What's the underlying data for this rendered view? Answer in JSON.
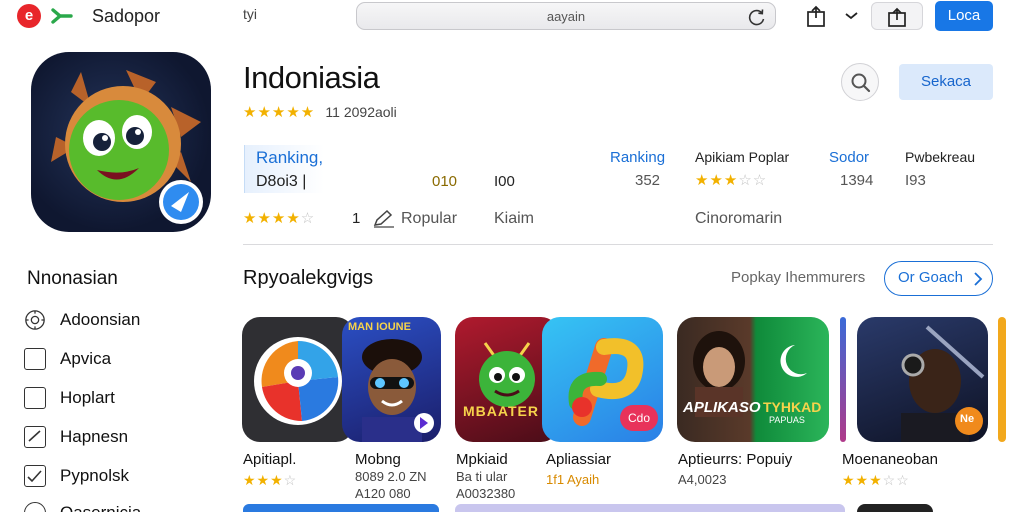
{
  "topbar": {
    "brand_letter": "e",
    "brand_name": "Sadopor",
    "small_label": "tyi",
    "url": "aayain",
    "login_label": "Loca"
  },
  "hero": {
    "title": "Indoniasia",
    "rating_stars": "★★★★",
    "rating_half": "★",
    "rating_text": "11 2092aoli",
    "search_button": "Sekaca",
    "ranking_label": "Ranking,",
    "ranking_value": "D8oi3 |",
    "col1_value": "010",
    "col2_value": "I00",
    "col3_label": "Ranking",
    "col3_value": "352",
    "col4_label": "Apikiam Poplar",
    "col4_stars_on": "★★★",
    "col4_stars_off": "☆☆",
    "col5_label": "Sodor",
    "col5_value": "1394",
    "col6_label": "Pwbekreau",
    "col6_value": "I93",
    "row3_stars_on": "★★★★",
    "row3_stars_off": "☆",
    "row3_count": "1",
    "popular_label": "Ropular",
    "claim_label": "Kiaim",
    "community_label": "Cinoromarin"
  },
  "sidebar": {
    "title": "Nnonasian",
    "items": [
      {
        "label": "Adoonsian"
      },
      {
        "label": "Apvica"
      },
      {
        "label": "Hoplart"
      },
      {
        "label": "Hapnesn"
      },
      {
        "label": "Pypnolsk"
      },
      {
        "label": "Oasernicia"
      }
    ]
  },
  "section": {
    "title": "Rpyoalekgvigs",
    "subtitle": "Popkay Ihemmurers",
    "button": "Or Goach"
  },
  "apps": [
    {
      "name": "Apitiapl.",
      "stars_on": "★★★",
      "stars_off": "☆"
    },
    {
      "name": "Mobng",
      "meta1": "8089 2.0 ZN",
      "meta2": "A120 080"
    },
    {
      "name": "Mpkiaid",
      "meta1": "Ba ti ular",
      "meta2": "A0032380"
    },
    {
      "name": "Apliassiar",
      "meta1": "1f1 Ayaih"
    },
    {
      "name": "Aptieurrs: Popuiy",
      "meta1": "A4,0023"
    },
    {
      "name": "Moenaneoban",
      "stars_on": "★★★",
      "stars_off": "☆☆"
    }
  ],
  "tile_text": {
    "mobng_banner": "MAN IOUNE",
    "mpkiaid_banner": "MBAATER",
    "apliassiar_badge": "Cdo",
    "aptieur_title": "APLIKASO",
    "aptieur_sub": "TYHKAD",
    "aptieur_small": "PAPUAS",
    "moen_badge": "Ne"
  },
  "colors": {
    "accent": "#1a6fd6",
    "login": "#1877e6",
    "star": "#f2b100",
    "star_off": "#c3c3c3"
  }
}
